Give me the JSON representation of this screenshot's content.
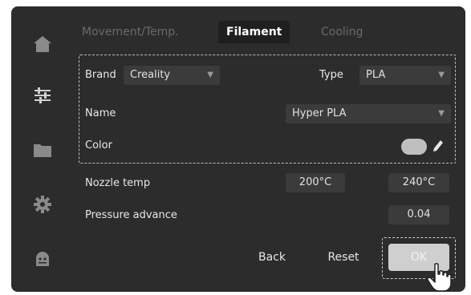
{
  "tabs": [
    {
      "label": "Movement/Temp."
    },
    {
      "label": "Filament"
    },
    {
      "label": "Cooling"
    }
  ],
  "active_tab": "Filament",
  "sidebar": {
    "items": [
      {
        "icon": "home-icon"
      },
      {
        "icon": "sliders-icon"
      },
      {
        "icon": "folder-icon"
      },
      {
        "icon": "gear-icon"
      },
      {
        "icon": "robot-icon"
      }
    ]
  },
  "filament": {
    "brand_label": "Brand",
    "brand_value": "Creality",
    "type_label": "Type",
    "type_value": "PLA",
    "name_label": "Name",
    "name_value": "Hyper PLA",
    "color_label": "Color",
    "color_value": "#bfbfbf"
  },
  "nozzle": {
    "label": "Nozzle temp",
    "min": "200°C",
    "max": "240°C"
  },
  "pressure": {
    "label": "Pressure advance",
    "value": "0.04"
  },
  "buttons": {
    "back": "Back",
    "reset": "Reset",
    "ok": "OK"
  }
}
